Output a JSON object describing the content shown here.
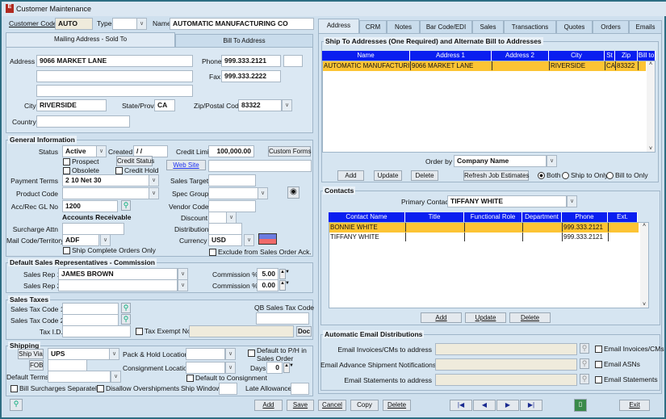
{
  "window": {
    "title": "Customer Maintenance"
  },
  "header": {
    "customer_code_label": "Customer Code",
    "customer_code": "AUTO",
    "type_label": "Type",
    "type_value": "",
    "name_label": "Name",
    "name_value": "AUTOMATIC MANUFACTURING CO"
  },
  "address_tabs": [
    "Mailing Address - Sold To",
    "Bill To Address"
  ],
  "mailing": {
    "address_label": "Address",
    "address1": "9066 MARKET LANE",
    "address2": "",
    "address3": "",
    "phone_label": "Phone",
    "phone": "999.333.2121",
    "phone_ext": "",
    "fax_label": "Fax",
    "fax": "999.333.2222",
    "city_label": "City",
    "city": "RIVERSIDE",
    "state_label": "State/Prov.",
    "state": "CA",
    "zip_label": "Zip/Postal Code",
    "zip": "83322",
    "country_label": "Country",
    "country": ""
  },
  "general": {
    "title": "General Information",
    "status_label": "Status",
    "status": "Active",
    "created_label": "Created",
    "created": " / /",
    "credit_limit_label": "Credit Limit",
    "credit_limit": "100,000.00",
    "custom_forms": "Custom Forms",
    "prospect": "Prospect",
    "obsolete": "Obsolete",
    "credit_status": "Credit Status",
    "credit_hold": "Credit Hold",
    "web_site": "Web Site",
    "web_site_value": "",
    "payment_terms_label": "Payment Terms",
    "payment_terms": "2 10 Net 30",
    "sales_target_label": "Sales Target",
    "product_code_label": "Product Code",
    "spec_group_label": "Spec Group",
    "gl_label": "Acc/Rec GL No",
    "gl": "1200",
    "gl_desc": "Accounts Receivable",
    "vendor_code_label": "Vendor Code",
    "discount_label": "Discount",
    "surcharge_label": "Surcharge Attn",
    "distribution_label": "Distribution",
    "mail_code_label": "Mail Code/Territory",
    "mail_code": "ADF",
    "currency_label": "Currency",
    "currency": "USD",
    "ship_complete": "Ship Complete Orders Only",
    "exclude_ack": "Exclude from Sales Order Ack."
  },
  "sales_reps": {
    "title": "Default Sales Representatives - Commission",
    "rep1_label": "Sales Rep 1",
    "rep1": "JAMES BROWN",
    "rep2_label": "Sales Rep 2",
    "rep2": "",
    "comm_label": "Commission %",
    "comm1": "5.00",
    "comm2": "0.00"
  },
  "taxes": {
    "title": "Sales Taxes",
    "code1_label": "Sales Tax Code 1",
    "code2_label": "Sales Tax Code 2",
    "taxid_label": "Tax I.D.",
    "qb_label": "QB Sales Tax Code",
    "exempt_label": "Tax Exempt No.",
    "doc": "Doc"
  },
  "shipping": {
    "title": "Shipping",
    "ship_via": "Ship Via",
    "ship_via_value": "UPS",
    "fob": "FOB",
    "default_terms_label": "Default Terms",
    "pack_hold_label": "Pack & Hold Location",
    "consign_label": "Consignment Location",
    "default_ph": "Default to P/H in",
    "default_ph2": "Sales Order",
    "days_label": "Days",
    "days": "0",
    "default_consign": "Default to Consignment",
    "bill_surcharges": "Bill Surcharges Separately",
    "disallow_over": "Disallow Overshipments",
    "ship_window_label": "Ship Window",
    "late_allowance_label": "Late Allowance"
  },
  "right_tabs": [
    "Address",
    "CRM",
    "Notes",
    "Bar Code/EDI",
    "Sales",
    "Transactions",
    "Quotes",
    "Orders",
    "Emails"
  ],
  "shipto": {
    "title": "Ship To Addresses (One Required)  and Alternate Bill to Addresses",
    "columns": [
      "Name",
      "Address 1",
      "Address 2",
      "City",
      "St",
      "Zip",
      "Bill to"
    ],
    "rows": [
      [
        "AUTOMATIC MANUFACTURING",
        "9066 MARKET LANE",
        "",
        "RIVERSIDE",
        "CA",
        "83322",
        ""
      ]
    ],
    "order_by_label": "Order by",
    "order_by": "Company Name",
    "add": "Add",
    "update": "Update",
    "delete": "Delete",
    "refresh": "Refresh Job Estimates",
    "radios": [
      "Both",
      "Ship to Only",
      "Bill to Only"
    ],
    "radio_selected": "Both"
  },
  "contacts": {
    "title": "Contacts",
    "primary_label": "Primary Contact",
    "primary": "TIFFANY WHITE",
    "columns": [
      "Contact Name",
      "Title",
      "Functional Role",
      "Department",
      "Phone",
      "Ext."
    ],
    "rows": [
      [
        "BONNIE WHITE",
        "",
        "",
        "",
        "999.333.2121",
        ""
      ],
      [
        "TIFFANY WHITE",
        "",
        "",
        "",
        "999.333.2121",
        ""
      ]
    ],
    "add": "Add",
    "update": "Update",
    "delete": "Delete"
  },
  "emails": {
    "title": "Automatic Email Distributions",
    "rows": [
      {
        "label": "Email Invoices/CMs to address",
        "check": "Email Invoices/CMs"
      },
      {
        "label": "Email Advance Shipment Notifications to",
        "check": "Email ASNs"
      },
      {
        "label": "Email Statements to address",
        "check": "Email Statements"
      }
    ]
  },
  "footer": {
    "add": "Add",
    "save": "Save",
    "cancel": "Cancel",
    "copy": "Copy",
    "delete": "Delete",
    "exit": "Exit"
  },
  "colors": {
    "header_blue": "#0a1ef0",
    "selected_row": "#fcc434",
    "background": "#cfe0ee"
  }
}
